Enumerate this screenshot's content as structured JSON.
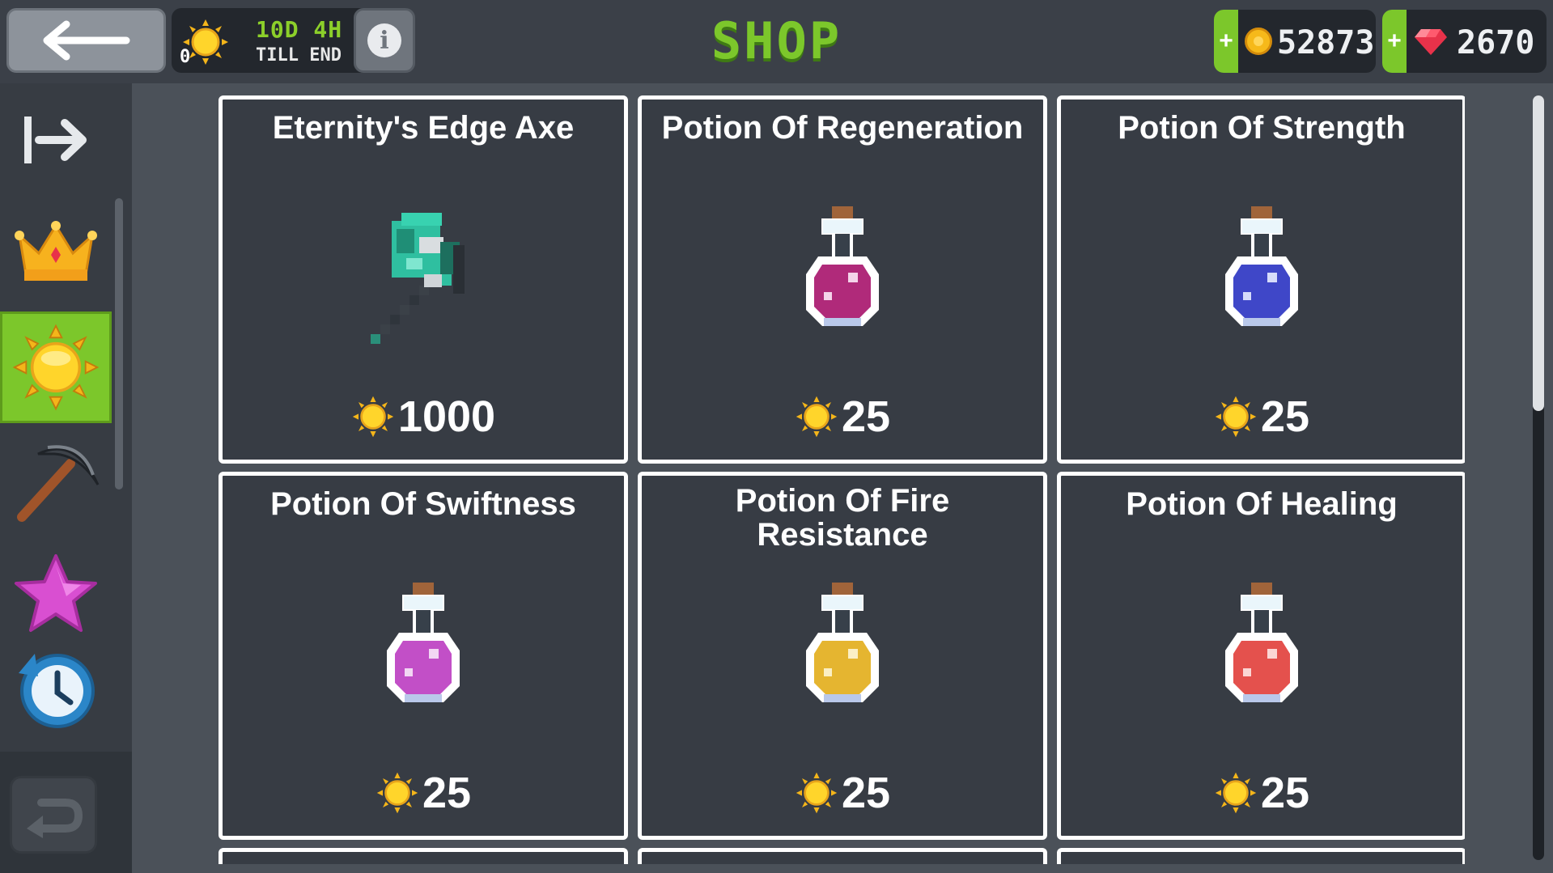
{
  "header": {
    "title": "SHOP",
    "back_label": "back",
    "event": {
      "count": "0",
      "time": "10D 4H",
      "sub": "TILL END"
    },
    "info_label": "i",
    "currencies": [
      {
        "icon": "gold-coin-icon",
        "value": "52873",
        "plus": "+"
      },
      {
        "icon": "red-gem-icon",
        "value": "2670",
        "plus": "+"
      }
    ]
  },
  "sidebar": {
    "items": [
      {
        "name": "exit",
        "icon": "exit-arrow-icon",
        "active": false
      },
      {
        "name": "crown",
        "icon": "crown-icon",
        "active": false
      },
      {
        "name": "sun-event",
        "icon": "sun-icon",
        "active": true
      },
      {
        "name": "pickaxe",
        "icon": "pickaxe-icon",
        "active": false
      },
      {
        "name": "star",
        "icon": "star-icon",
        "active": false
      },
      {
        "name": "timed",
        "icon": "clock-refresh-icon",
        "active": false
      }
    ],
    "undo_icon": "undo-arrow-icon"
  },
  "items": [
    {
      "title": "Eternity's Edge Axe",
      "price": "1000",
      "art": "axe",
      "color": "#2fbfa0"
    },
    {
      "title": "Potion Of Regeneration",
      "price": "25",
      "art": "potion",
      "color": "#b02a7a"
    },
    {
      "title": "Potion Of Strength",
      "price": "25",
      "art": "potion",
      "color": "#3f47c8"
    },
    {
      "title": "Potion Of Swiftness",
      "price": "25",
      "art": "potion",
      "color": "#c24fc7"
    },
    {
      "title": "Potion Of Fire Resistance",
      "price": "25",
      "art": "potion",
      "color": "#e5b530"
    },
    {
      "title": "Potion Of Healing",
      "price": "25",
      "art": "potion",
      "color": "#e4514d"
    }
  ],
  "colors": {
    "accent": "#7cc72b",
    "card": "#373c44",
    "background": "#4b5159"
  }
}
